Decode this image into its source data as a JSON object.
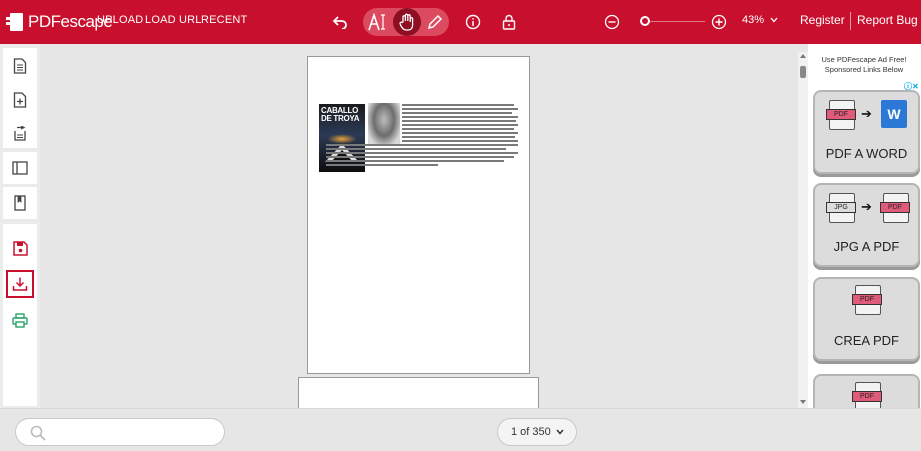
{
  "header": {
    "logo_text": "PDFescape",
    "nav": [
      "UPLOAD",
      "LOAD URL",
      "RECENT"
    ],
    "zoom_level": "43%",
    "register_label": "Register",
    "report_bug_label": "Report Bug"
  },
  "toolbar_icons": [
    "undo-icon",
    "text-tool-icon",
    "hand-tool-icon",
    "pencil-icon",
    "info-icon",
    "lock-icon",
    "zoom-out-icon",
    "zoom-in-icon"
  ],
  "sidebar_icons": [
    "document-icon",
    "add-page-icon",
    "move-page-icon",
    "sidebar-toggle-icon",
    "bookmark-icon",
    "save-icon",
    "download-icon",
    "print-icon"
  ],
  "document": {
    "book_title_line1": "CABALLO",
    "book_title_line2": "DE TROYA"
  },
  "ad": {
    "header": "Use PDFescape Ad Free! Sponsored Links Below",
    "cards": [
      {
        "label": "PDF A WORD",
        "icon_text_1": "PDF",
        "icon_text_2": "W"
      },
      {
        "label": "JPG A PDF",
        "icon_text_1": "JPG",
        "icon_text_2": "PDF"
      },
      {
        "label": "CREA PDF",
        "icon_text_1": "PDF"
      },
      {
        "icon_text_1": "PDF"
      }
    ]
  },
  "footer": {
    "search_placeholder": "",
    "page_indicator": "1 of 350"
  },
  "colors": {
    "brand_red": "#c8102e",
    "active_tool": "#8e0f22"
  }
}
